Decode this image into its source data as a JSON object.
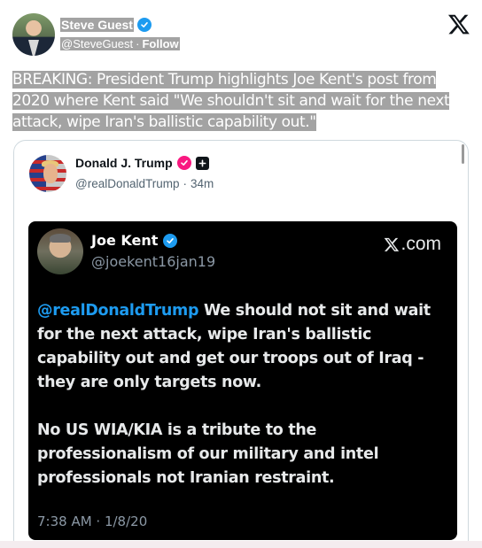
{
  "post": {
    "author_name": "Steve Guest",
    "author_handle": "@SteveGuest",
    "separator": "·",
    "follow_label": "Follow",
    "text": "BREAKING: President Trump highlights Joe Kent's post from 2020 where Kent said \"We shouldn't sit and wait for the next attack, wipe Iran's ballistic capability out.\""
  },
  "quote": {
    "author_name": "Donald J. Trump",
    "author_handle": "@realDonaldTrump",
    "separator": "·",
    "time_ago": "34m"
  },
  "embedded": {
    "author_name": "Joe Kent",
    "author_handle": "@joekent16jan19",
    "site_label": ".com",
    "mention": "@realDonaldTrump",
    "paragraph1": " We should not sit and wait for the next attack, wipe Iran's ballistic capability out and get our troops out of Iraq - they are only targets now.",
    "paragraph2": "No US WIA/KIA is a tribute to the professionalism of our military and intel professionals not Iranian restraint.",
    "timestamp": "7:38 AM · 1/8/20"
  },
  "colors": {
    "accent": "#1d9bf0",
    "highlight": "#a3a3a3",
    "pink_badge": "#f91880"
  },
  "icons": [
    "verified-badge-icon",
    "x-logo-icon",
    "pink-badge-icon",
    "square-plus-icon"
  ]
}
